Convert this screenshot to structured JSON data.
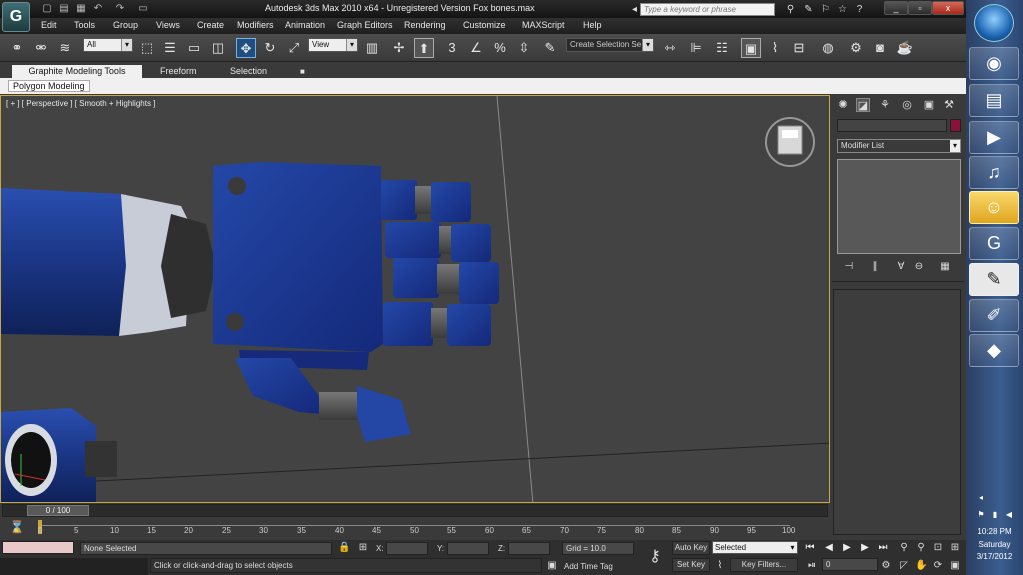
{
  "window": {
    "title": "Autodesk 3ds Max  2010 x64    - Unregistered Version       Fox bones.max",
    "search_placeholder": "Type a keyword or phrase",
    "logo": "G",
    "min": "_",
    "restore": "▫",
    "close": "x"
  },
  "menu": [
    "Edit",
    "Tools",
    "Group",
    "Views",
    "Create",
    "Modifiers",
    "Animation",
    "Graph Editors",
    "Rendering",
    "Customize",
    "MAXScript",
    "Help"
  ],
  "toolbar": {
    "selection_filter": "All",
    "ref_coord": "View",
    "named_selection": "Create Selection Se",
    "snap_label": "3"
  },
  "ribbon": {
    "tabs": [
      "Graphite Modeling Tools",
      "Freeform",
      "Selection"
    ],
    "subtab": "Polygon Modeling"
  },
  "viewport": {
    "label": "[ + ] [ Perspective ] [ Smooth + Highlights ]",
    "accent": "#c9a840",
    "bg": "#434343",
    "model_color": "#1c3a8c"
  },
  "command_panel": {
    "modifier_list": "Modifier List",
    "object_color": "#8a1238"
  },
  "timeline": {
    "frame_display": "0 / 100",
    "ticks": [
      "0",
      "5",
      "10",
      "15",
      "20",
      "25",
      "30",
      "35",
      "40",
      "45",
      "50",
      "55",
      "60",
      "65",
      "70",
      "75",
      "80",
      "85",
      "90",
      "95",
      "100"
    ]
  },
  "status": {
    "selection": "None Selected",
    "prompt": "Click or click-and-drag to select objects",
    "x_label": "X:",
    "y_label": "Y:",
    "z_label": "Z:",
    "grid": "Grid = 10.0",
    "add_time_tag": "Add Time Tag",
    "auto_key": "Auto Key",
    "set_key": "Set Key",
    "key_mode": "Selected",
    "key_filters": "Key Filters...",
    "frame": "0"
  },
  "taskbar": {
    "time": "10:28 PM",
    "day": "Saturday",
    "date": "3/17/2012"
  }
}
